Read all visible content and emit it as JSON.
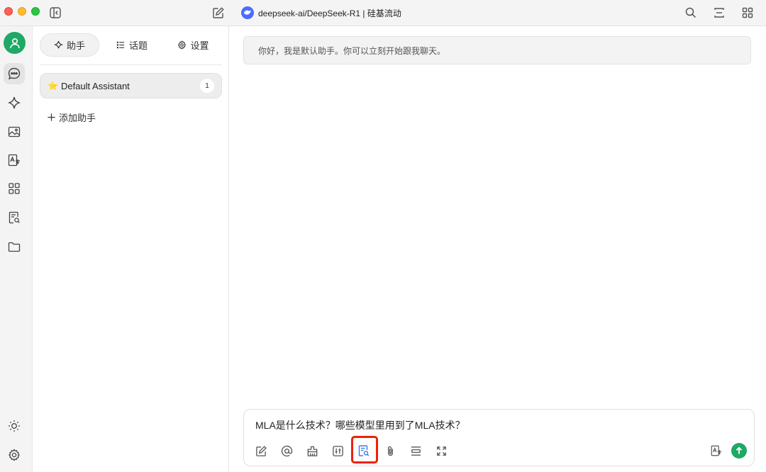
{
  "window": {
    "model_title": "deepseek-ai/DeepSeek-R1 | 硅基流动"
  },
  "panel": {
    "tabs": [
      {
        "label": "助手",
        "icon": "sparkle-icon",
        "active": true
      },
      {
        "label": "话题",
        "icon": "list-icon",
        "active": false
      },
      {
        "label": "设置",
        "icon": "gear-icon",
        "active": false
      }
    ],
    "assistant": {
      "name": "Default Assistant",
      "count": "1",
      "icon": "star-emoji"
    },
    "add_assistant_label": "添加助手"
  },
  "chat": {
    "welcome_message": "你好，我是默认助手。你可以立刻开始跟我聊天。",
    "input_value": "MLA是什么技术？哪些模型里用到了MLA技术？"
  },
  "colors": {
    "accent_green": "#1fa866",
    "highlight_red": "#ee2200",
    "active_blue": "#3b7ae8"
  }
}
